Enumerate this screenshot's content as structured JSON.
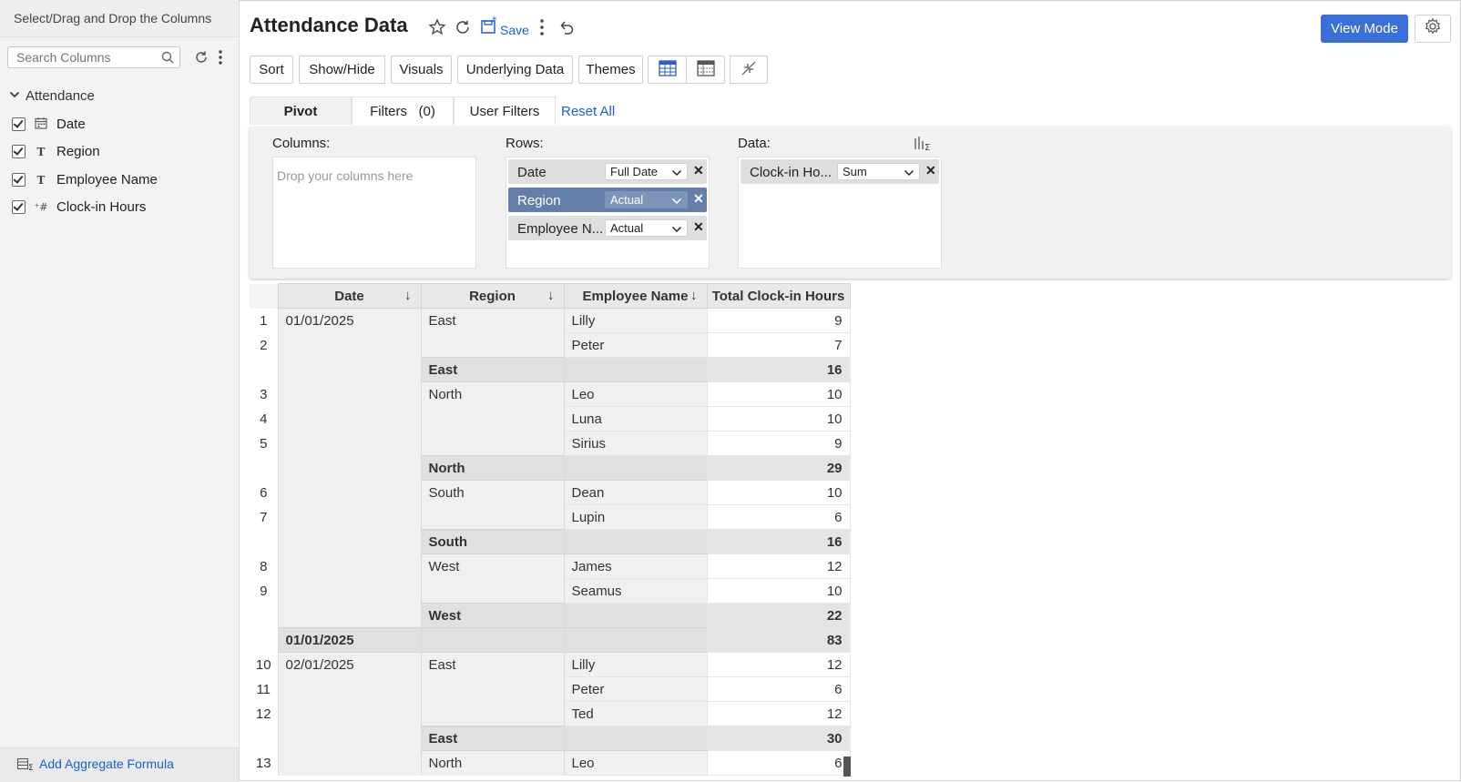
{
  "sidebar": {
    "header": "Select/Drag and Drop the Columns",
    "search_placeholder": "Search Columns",
    "group": "Attendance",
    "columns": [
      {
        "label": "Date",
        "icon": "calendar-icon"
      },
      {
        "label": "Region",
        "icon": "text-type-icon"
      },
      {
        "label": "Employee Name",
        "icon": "text-type-icon"
      },
      {
        "label": "Clock-in Hours",
        "icon": "number-type-icon"
      }
    ],
    "footer": "Add Aggregate Formula"
  },
  "header": {
    "title": "Attendance Data",
    "save_label": "Save",
    "view_mode_label": "View Mode"
  },
  "toolbar": {
    "sort": "Sort",
    "showhide": "Show/Hide",
    "visuals": "Visuals",
    "underlying": "Underlying Data",
    "themes": "Themes"
  },
  "tabs": {
    "pivot": "Pivot",
    "filters": "Filters",
    "filters_count": "(0)",
    "user_filters": "User Filters",
    "reset_all": "Reset All"
  },
  "pivot": {
    "columns_label": "Columns:",
    "columns_placeholder": "Drop your columns here",
    "rows_label": "Rows:",
    "rows": [
      {
        "name": "Date",
        "option": "Full Date"
      },
      {
        "name": "Region",
        "option": "Actual"
      },
      {
        "name": "Employee N...",
        "option": "Actual"
      }
    ],
    "data_label": "Data:",
    "data": [
      {
        "name": "Clock-in Ho...",
        "option": "Sum"
      }
    ]
  },
  "table": {
    "headers": {
      "date": "Date",
      "region": "Region",
      "employee": "Employee Name",
      "value": "Total Clock-in Hours"
    },
    "rows": [
      {
        "rn": "1",
        "date": "01/01/2025",
        "region": "East",
        "employee": "Lilly",
        "value": "9"
      },
      {
        "rn": "2",
        "date": "",
        "region": "",
        "employee": "Peter",
        "value": "7"
      },
      {
        "rn": "",
        "date": "",
        "region": "East",
        "employee": "",
        "value": "16",
        "type": "sub"
      },
      {
        "rn": "3",
        "date": "",
        "region": "North",
        "employee": "Leo",
        "value": "10"
      },
      {
        "rn": "4",
        "date": "",
        "region": "",
        "employee": "Luna",
        "value": "10"
      },
      {
        "rn": "5",
        "date": "",
        "region": "",
        "employee": "Sirius",
        "value": "9"
      },
      {
        "rn": "",
        "date": "",
        "region": "North",
        "employee": "",
        "value": "29",
        "type": "sub"
      },
      {
        "rn": "6",
        "date": "",
        "region": "South",
        "employee": "Dean",
        "value": "10"
      },
      {
        "rn": "7",
        "date": "",
        "region": "",
        "employee": "Lupin",
        "value": "6"
      },
      {
        "rn": "",
        "date": "",
        "region": "South",
        "employee": "",
        "value": "16",
        "type": "sub"
      },
      {
        "rn": "8",
        "date": "",
        "region": "West",
        "employee": "James",
        "value": "12"
      },
      {
        "rn": "9",
        "date": "",
        "region": "",
        "employee": "Seamus",
        "value": "10"
      },
      {
        "rn": "",
        "date": "",
        "region": "West",
        "employee": "",
        "value": "22",
        "type": "sub"
      },
      {
        "rn": "",
        "date": "01/01/2025",
        "region": "",
        "employee": "",
        "value": "83",
        "type": "dsub"
      },
      {
        "rn": "10",
        "date": "02/01/2025",
        "region": "East",
        "employee": "Lilly",
        "value": "12"
      },
      {
        "rn": "11",
        "date": "",
        "region": "",
        "employee": "Peter",
        "value": "6"
      },
      {
        "rn": "12",
        "date": "",
        "region": "",
        "employee": "Ted",
        "value": "12"
      },
      {
        "rn": "",
        "date": "",
        "region": "East",
        "employee": "",
        "value": "30",
        "type": "sub"
      },
      {
        "rn": "13",
        "date": "",
        "region": "North",
        "employee": "Leo",
        "value": "6"
      }
    ]
  },
  "colors": {
    "accent": "#3a6fd8",
    "link": "#1a5fd1",
    "selected_chip": "#627ea9"
  }
}
